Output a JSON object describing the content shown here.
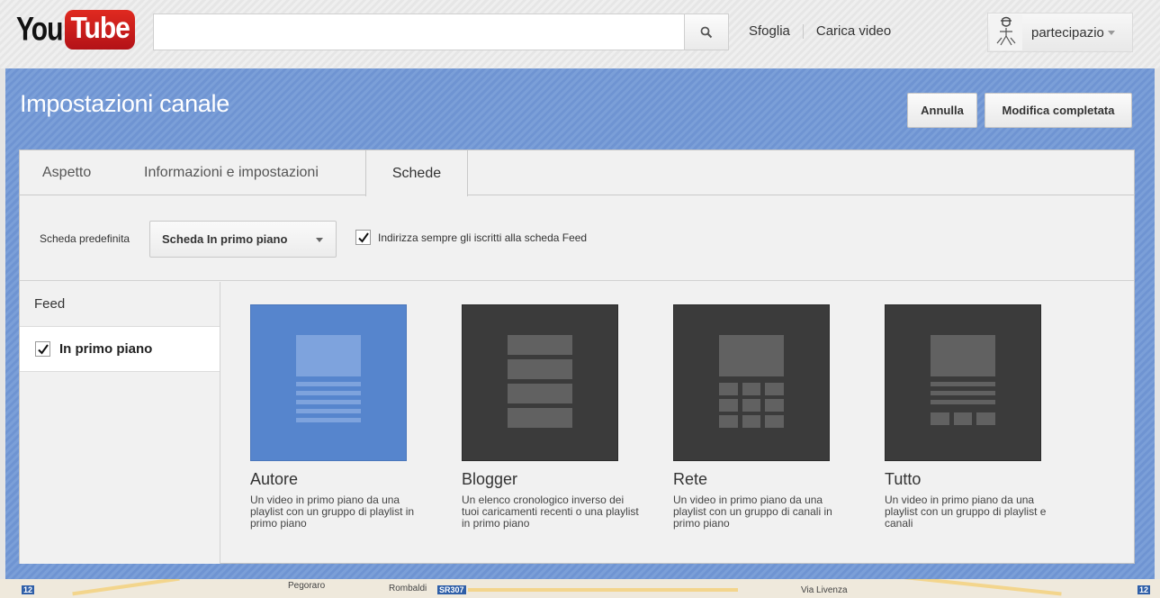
{
  "header": {
    "logo_you": "You",
    "logo_tube": "Tube",
    "search_value": "",
    "nav_browse": "Sfoglia",
    "nav_upload": "Carica video",
    "username": "partecipazio"
  },
  "page": {
    "title": "Impostazioni canale",
    "cancel_label": "Annulla",
    "done_label": "Modifica completata"
  },
  "tabs": {
    "appearance": "Aspetto",
    "info": "Informazioni e impostazioni",
    "tabs": "Schede"
  },
  "options": {
    "default_tab_label": "Scheda predefinita",
    "default_tab_value": "Scheda In primo piano",
    "redirect_label": "Indirizza sempre gli iscritti alla scheda Feed",
    "redirect_checked": true
  },
  "side": {
    "feed": "Feed",
    "featured": "In primo piano",
    "featured_checked": true
  },
  "layouts": [
    {
      "title": "Autore",
      "desc": "Un video in primo piano da una playlist con un gruppo di playlist in primo piano",
      "selected": true
    },
    {
      "title": "Blogger",
      "desc": "Un elenco cronologico inverso dei tuoi caricamenti recenti o una playlist in primo piano",
      "selected": false
    },
    {
      "title": "Rete",
      "desc": "Un video in primo piano da una playlist con un gruppo di canali in primo piano",
      "selected": false
    },
    {
      "title": "Tutto",
      "desc": "Un video in primo piano da una playlist con un gruppo di playlist e canali",
      "selected": false
    }
  ],
  "map": {
    "label1": "Pegoraro",
    "label2": "Rombaldi",
    "shield": "SR307",
    "label3": "Via Livenza",
    "badge_left": "12",
    "badge_right": "12"
  },
  "colors": {
    "accent_blue": "#6f94d2",
    "selected_card": "#5685cd",
    "dark_card": "#3b3b3b"
  }
}
